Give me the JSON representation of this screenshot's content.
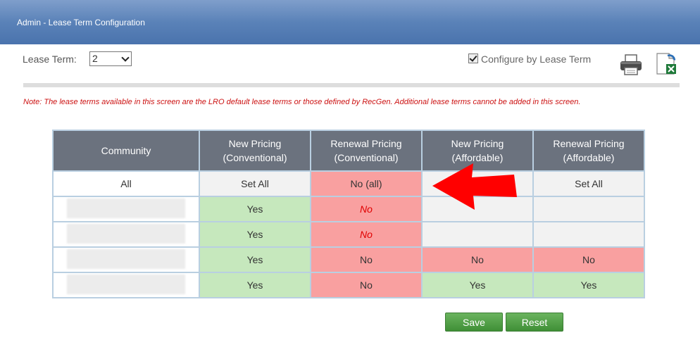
{
  "header": {
    "title": "Admin - Lease Term Configuration"
  },
  "lease_term": {
    "label": "Lease Term:",
    "selected": "2"
  },
  "configure": {
    "label": "Configure by Lease Term",
    "checked": true
  },
  "note": "Note: The lease terms available in this screen are the LRO default lease terms or those defined by RecGen. Additional lease terms cannot be added in this screen.",
  "table": {
    "headers": [
      [
        "Community"
      ],
      [
        "New Pricing",
        "(Conventional)"
      ],
      [
        "Renewal Pricing",
        "(Conventional)"
      ],
      [
        "New Pricing",
        "(Affordable)"
      ],
      [
        "Renewal Pricing",
        "(Affordable)"
      ]
    ],
    "all_row": {
      "community": "All",
      "new_conv": "Set All",
      "renew_conv": "No (all)",
      "new_aff": "",
      "renew_aff": "Set All"
    },
    "rows": [
      {
        "community": "",
        "new_conv": "Yes",
        "renew_conv": "No",
        "new_aff": "",
        "renew_aff": ""
      },
      {
        "community": "",
        "new_conv": "Yes",
        "renew_conv": "No",
        "new_aff": "",
        "renew_aff": ""
      },
      {
        "community": "",
        "new_conv": "Yes",
        "renew_conv": "No",
        "new_aff": "No",
        "renew_aff": "No"
      },
      {
        "community": "",
        "new_conv": "Yes",
        "renew_conv": "No",
        "new_aff": "Yes",
        "renew_aff": "Yes"
      }
    ]
  },
  "buttons": {
    "save": "Save",
    "reset": "Reset"
  },
  "icons": {
    "print": "printer-icon",
    "export": "excel-export-icon",
    "annotation": "red-arrow"
  },
  "colors": {
    "header": "#5a82b8",
    "green": "#c6e8bd",
    "red": "#f9a0a0",
    "table_header": "#6b727e",
    "button": "#4a9a40"
  }
}
